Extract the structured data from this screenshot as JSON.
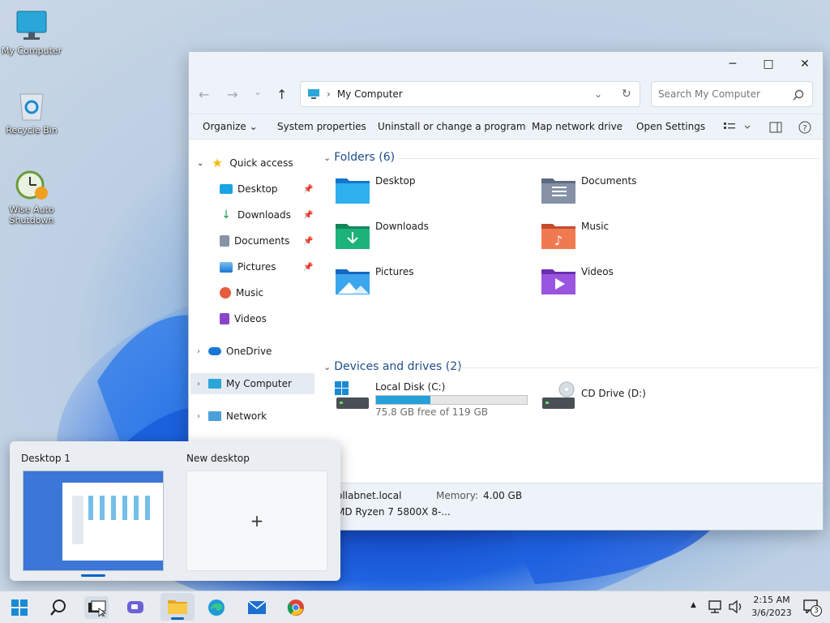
{
  "desktop": {
    "icons": [
      {
        "label": "My Computer",
        "icon": "monitor-icon"
      },
      {
        "label": "Recycle Bin",
        "icon": "recycle-bin-icon"
      },
      {
        "label": "Wise Auto Shutdown",
        "icon": "clock-shutdown-icon"
      }
    ]
  },
  "window": {
    "controls": {
      "minimize": "─",
      "maximize": "□",
      "close": "✕"
    },
    "nav": {
      "back": "←",
      "forward": "→",
      "recent": "⌄",
      "up": "↑"
    },
    "address": {
      "separator": "›",
      "location": "My Computer",
      "dropdown": "⌄",
      "refresh": "↻"
    },
    "search": {
      "placeholder": "Search My Computer"
    },
    "commands": {
      "organize": "Organize",
      "system_properties": "System properties",
      "uninstall": "Uninstall or change a program",
      "map_drive": "Map network drive",
      "open_settings": "Open Settings"
    },
    "sidebar": {
      "quick_access": "Quick access",
      "items": [
        "Desktop",
        "Downloads",
        "Documents",
        "Pictures",
        "Music",
        "Videos"
      ],
      "onedrive": "OneDrive",
      "my_computer": "My Computer",
      "network": "Network"
    },
    "content": {
      "folders_header": "Folders (6)",
      "folders": [
        "Desktop",
        "Documents",
        "Downloads",
        "Music",
        "Pictures",
        "Videos"
      ],
      "drives_header": "Devices and drives (2)",
      "drives": [
        {
          "name": "Local Disk (C:)",
          "free": "75.8 GB free of 119 GB",
          "used_fraction": 0.36
        },
        {
          "name": "CD Drive (D:)"
        }
      ]
    },
    "status": {
      "domain": "ollabnet.local",
      "memory_label": "Memory:",
      "memory_value": "4.00 GB",
      "cpu": "MD Ryzen 7 5800X 8-..."
    }
  },
  "taskview": {
    "desktop1": "Desktop 1",
    "new_desktop": "New desktop",
    "plus": "+"
  },
  "taskbar": {
    "time": "2:15 AM",
    "date": "3/6/2023",
    "notifications": "3",
    "tray_arrow": "▲"
  },
  "colors": {
    "accent": "#0067c0",
    "folder_blue": "#1aa3e6",
    "progress": "#26a0da"
  }
}
